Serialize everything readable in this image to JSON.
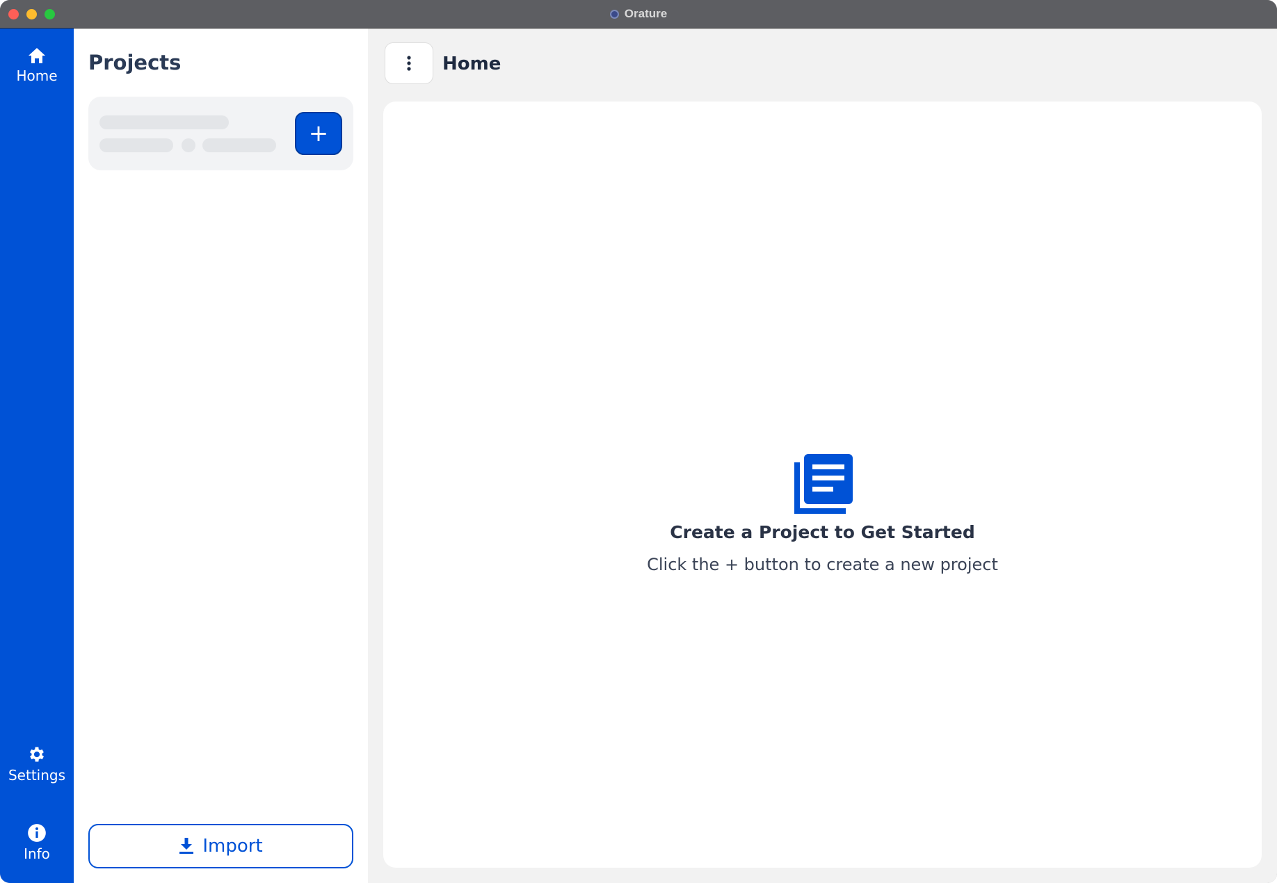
{
  "window": {
    "title": "Orature"
  },
  "nav": {
    "home_label": "Home",
    "settings_label": "Settings",
    "info_label": "Info"
  },
  "projects": {
    "title": "Projects",
    "add_label": "+",
    "import_label": "Import"
  },
  "main": {
    "title": "Home",
    "empty_title": "Create a Project to Get Started",
    "empty_subtitle": "Click the + button to create a new project"
  },
  "colors": {
    "accent": "#0052d6",
    "rail": "#0052d6",
    "titlebar": "#5d5e62"
  },
  "icons": {
    "home": "home-icon",
    "settings": "gear-icon",
    "info": "info-icon",
    "import": "download-icon",
    "menu": "more-vertical-icon",
    "empty": "book-stack-icon"
  }
}
